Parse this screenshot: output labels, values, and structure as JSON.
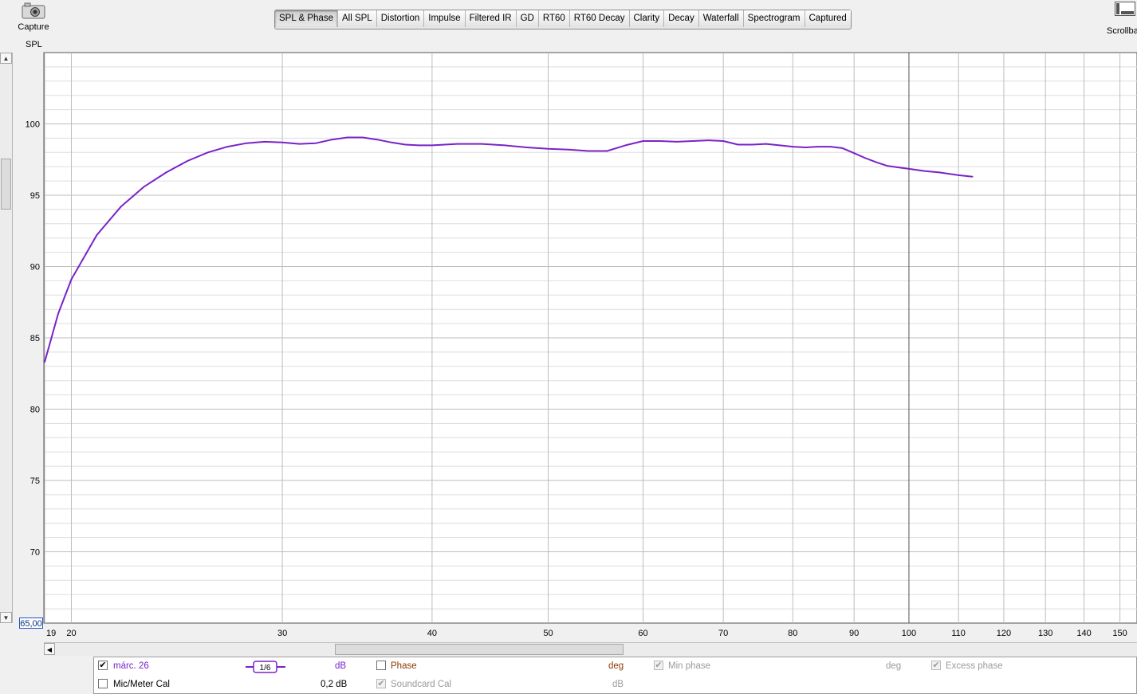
{
  "capture": {
    "label": "Capture"
  },
  "toolbar": {
    "scrollbars_label": "Scrollbars"
  },
  "tabs": [
    {
      "label": "SPL & Phase",
      "active": true
    },
    {
      "label": "All SPL"
    },
    {
      "label": "Distortion"
    },
    {
      "label": "Impulse"
    },
    {
      "label": "Filtered IR"
    },
    {
      "label": "GD"
    },
    {
      "label": "RT60"
    },
    {
      "label": "RT60 Decay"
    },
    {
      "label": "Clarity"
    },
    {
      "label": "Decay"
    },
    {
      "label": "Waterfall"
    },
    {
      "label": "Spectrogram"
    },
    {
      "label": "Captured"
    }
  ],
  "axis": {
    "y_label": "SPL",
    "y_min_value": "65,00"
  },
  "chart_data": {
    "type": "line",
    "ylabel": "SPL",
    "xscale": "log",
    "xlim": [
      19,
      155
    ],
    "ylim": [
      65,
      105
    ],
    "x_ticks": [
      "19",
      "20",
      "30",
      "40",
      "50",
      "60",
      "70",
      "80",
      "90",
      "100",
      "110",
      "120",
      "130",
      "140",
      "150"
    ],
    "x_tick_values": [
      19,
      20,
      30,
      40,
      50,
      60,
      70,
      80,
      90,
      100,
      110,
      120,
      130,
      140,
      150
    ],
    "y_ticks": [
      70,
      75,
      80,
      85,
      90,
      95,
      100
    ],
    "grid": true,
    "series": [
      {
        "color": "#7a22c8",
        "x": [
          19,
          19.5,
          20,
          21,
          22,
          23,
          24,
          25,
          26,
          27,
          28,
          29,
          30,
          31,
          32,
          33,
          34,
          35,
          36,
          37,
          38,
          39,
          40,
          42,
          44,
          46,
          48,
          50,
          52,
          54,
          56,
          58,
          60,
          62,
          64,
          66,
          68,
          70,
          72,
          74,
          76,
          78,
          80,
          82,
          84,
          86,
          88,
          90,
          92,
          94,
          96,
          98,
          100,
          103,
          106,
          110,
          113
        ],
        "y": [
          83.3,
          86.7,
          89.1,
          92.2,
          94.2,
          95.6,
          96.6,
          97.4,
          98.0,
          98.4,
          98.65,
          98.75,
          98.7,
          98.6,
          98.65,
          98.9,
          99.05,
          99.05,
          98.9,
          98.7,
          98.55,
          98.5,
          98.5,
          98.6,
          98.6,
          98.5,
          98.35,
          98.25,
          98.2,
          98.1,
          98.1,
          98.5,
          98.8,
          98.8,
          98.75,
          98.8,
          98.85,
          98.8,
          98.55,
          98.55,
          98.6,
          98.5,
          98.4,
          98.35,
          98.4,
          98.4,
          98.3,
          97.95,
          97.6,
          97.3,
          97.05,
          96.95,
          96.85,
          96.7,
          96.6,
          96.4,
          96.3
        ]
      }
    ]
  },
  "legend": {
    "row1": {
      "name": "márc. 26",
      "smoothing": "1/6",
      "unit": "dB",
      "phase_label": "Phase",
      "phase_unit": "deg",
      "min_phase_label": "Min phase",
      "min_phase_unit": "deg",
      "excess_phase_label": "Excess phase"
    },
    "row2": {
      "mic_label": "Mic/Meter Cal",
      "mic_value": "0,2 dB",
      "soundcard_label": "Soundcard Cal",
      "soundcard_unit": "dB"
    }
  },
  "colors": {
    "trace": "#7a22c8",
    "grid_major": "#bdbdbd",
    "grid_minor": "#dedede"
  }
}
